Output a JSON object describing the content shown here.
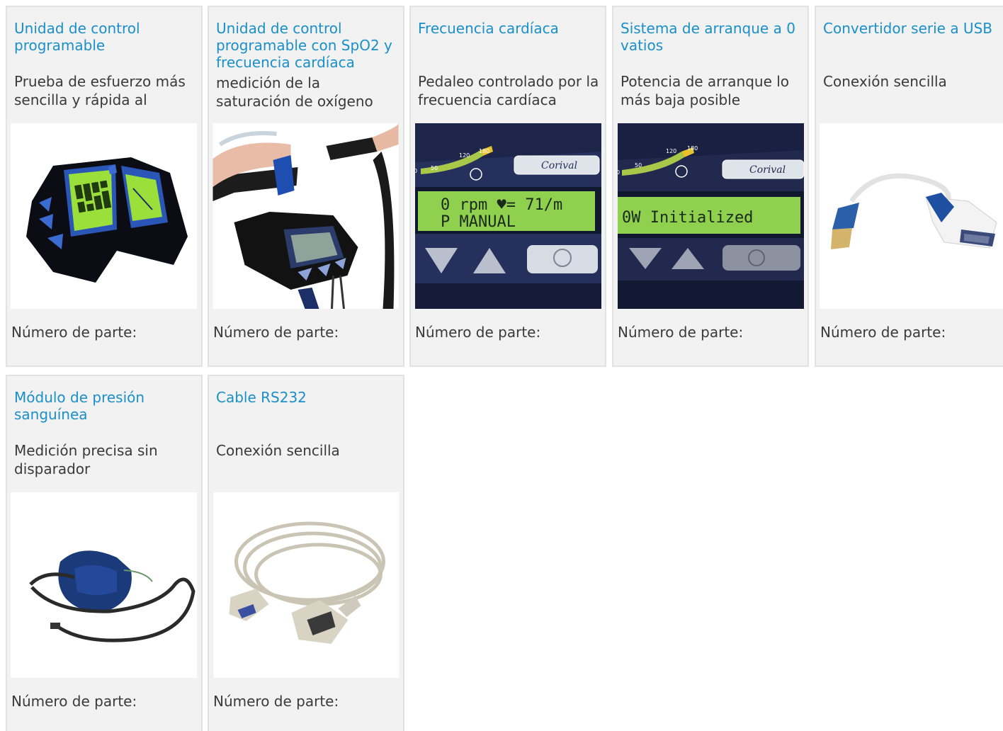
{
  "cards": [
    {
      "title": "Unidad de control programable",
      "desc": "Prueba de esfuerzo más sencilla y rápida al",
      "part_label": "Número de parte:",
      "image_icon": "control-unit-icon"
    },
    {
      "title": "Unidad de control programable con SpO2 y frecuencia cardíaca",
      "desc": "medición de la saturación de oxígeno",
      "part_label": "Número de parte:",
      "image_icon": "bike-control-unit-icon"
    },
    {
      "title": "Frecuencia cardíaca",
      "desc": "Pedaleo controlado por la frecuencia cardíaca",
      "part_label": "Número de parte:",
      "image_icon": "heart-rate-display-icon",
      "display": {
        "scale_labels": [
          "0",
          "50",
          "120",
          "180"
        ],
        "brand": "Corival",
        "line1": "0 rpm  ♥= 71/m",
        "line2": "P       MANUAL"
      }
    },
    {
      "title": "Sistema de arranque a 0 vatios",
      "desc": "Potencia de arranque lo más baja posible",
      "part_label": "Número de parte:",
      "image_icon": "zero-watt-display-icon",
      "display": {
        "scale_labels": [
          "0",
          "50",
          "120",
          "180"
        ],
        "brand": "Corival",
        "line1": "0W Initialized"
      }
    },
    {
      "title": "Convertidor serie a USB",
      "desc": "Conexión sencilla",
      "part_label": "Número de parte:",
      "image_icon": "usb-serial-cable-icon"
    },
    {
      "title": "Módulo de presión sanguínea",
      "desc": "Medición precisa sin disparador",
      "part_label": "Número de parte:",
      "image_icon": "blood-pressure-cuff-icon"
    },
    {
      "title": "Cable RS232",
      "desc": "Conexión sencilla",
      "part_label": "Número de parte:",
      "image_icon": "rs232-cable-icon"
    }
  ],
  "colors": {
    "link": "#1a8fc9",
    "card_bg": "#f2f2f2",
    "card_border": "#e2e2e2",
    "text": "#3a3a3a",
    "lcd_green": "#8fd14f"
  }
}
